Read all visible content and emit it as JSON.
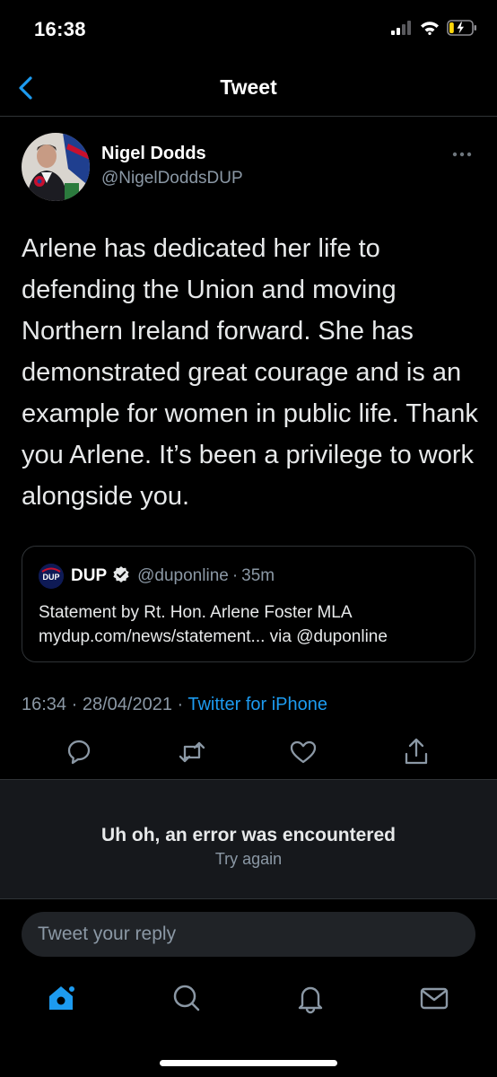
{
  "status_bar": {
    "time": "16:38",
    "battery_level": 0.2,
    "cellular_bars": 2
  },
  "nav": {
    "title": "Tweet",
    "back_icon": "chevron-left-icon"
  },
  "tweet": {
    "author_name": "Nigel Dodds",
    "author_handle": "@NigelDoddsDUP",
    "text": "Arlene has dedicated her life to defending the Union and moving Northern Ireland forward. She has demonstrated great courage and is an example for women in public life. Thank you Arlene. It’s been a privilege to work alongside you.",
    "time": "16:34",
    "date": "28/04/2021",
    "meta_separator": " · ",
    "source": "Twitter for iPhone"
  },
  "quote": {
    "name": "DUP",
    "handle": "@duponline",
    "time": "35m",
    "dot": "·",
    "avatar_text": "DUP",
    "line1": "Statement by Rt. Hon. Arlene Foster MLA",
    "line2": "mydup.com/news/statement... via @duponline"
  },
  "actions": [
    "reply-icon",
    "retweet-icon",
    "like-icon",
    "share-icon"
  ],
  "error": {
    "title": "Uh oh, an error was encountered",
    "retry": "Try again"
  },
  "reply": {
    "placeholder": "Tweet your reply"
  },
  "tabs": [
    "home-icon",
    "search-icon",
    "notifications-icon",
    "messages-icon"
  ],
  "colors": {
    "accent": "#1d9bf0",
    "background": "#000000",
    "secondary_text": "#8b98a5",
    "panel": "#16181c",
    "battery_charging": "#ffd60a"
  }
}
